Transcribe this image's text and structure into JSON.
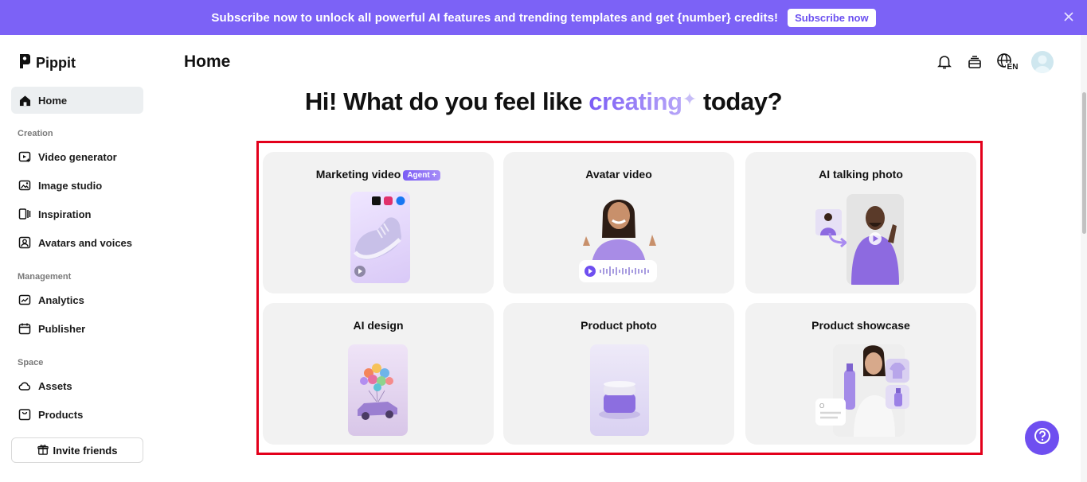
{
  "banner": {
    "text": "Subscribe now to unlock all powerful AI features and trending templates and get {number} credits!",
    "button": "Subscribe now"
  },
  "app": {
    "name": "Pippit"
  },
  "sidebar": {
    "home": "Home",
    "sections": {
      "creation": "Creation",
      "management": "Management",
      "space": "Space"
    },
    "creation_items": [
      "Video generator",
      "Image studio",
      "Inspiration",
      "Avatars and voices"
    ],
    "management_items": [
      "Analytics",
      "Publisher"
    ],
    "space_items": [
      "Assets",
      "Products"
    ],
    "invite": "Invite friends"
  },
  "header": {
    "title": "Home",
    "lang": "EN"
  },
  "headline": {
    "before": "Hi! What do you feel like ",
    "highlight": "creating",
    "after": " today?"
  },
  "cards": [
    {
      "title": "Marketing video",
      "badge": "Agent +"
    },
    {
      "title": "Avatar video"
    },
    {
      "title": "AI talking photo"
    },
    {
      "title": "AI design"
    },
    {
      "title": "Product photo"
    },
    {
      "title": "Product showcase"
    }
  ],
  "colors": {
    "brand": "#7c62f6",
    "accent": "#6f4ff0",
    "highlight_box": "#e3001b"
  }
}
